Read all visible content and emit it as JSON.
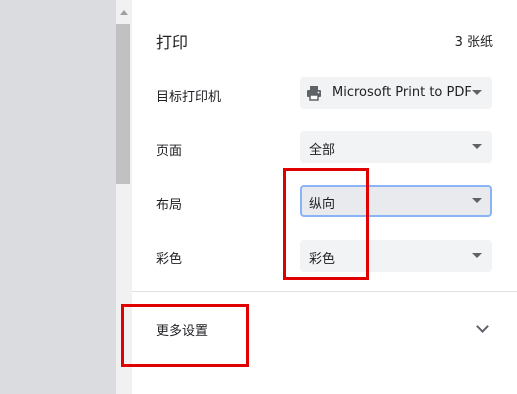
{
  "header": {
    "title": "打印",
    "sheet_count": "3 张纸"
  },
  "settings": {
    "destination": {
      "label": "目标打印机",
      "value": "Microsoft Print to PDF",
      "icon": "printer-icon"
    },
    "pages": {
      "label": "页面",
      "value": "全部"
    },
    "layout": {
      "label": "布局",
      "value": "纵向"
    },
    "color": {
      "label": "彩色",
      "value": "彩色"
    }
  },
  "more_settings": {
    "label": "更多设置",
    "icon": "chevron-down-icon"
  },
  "annotation_color": "#e00000"
}
